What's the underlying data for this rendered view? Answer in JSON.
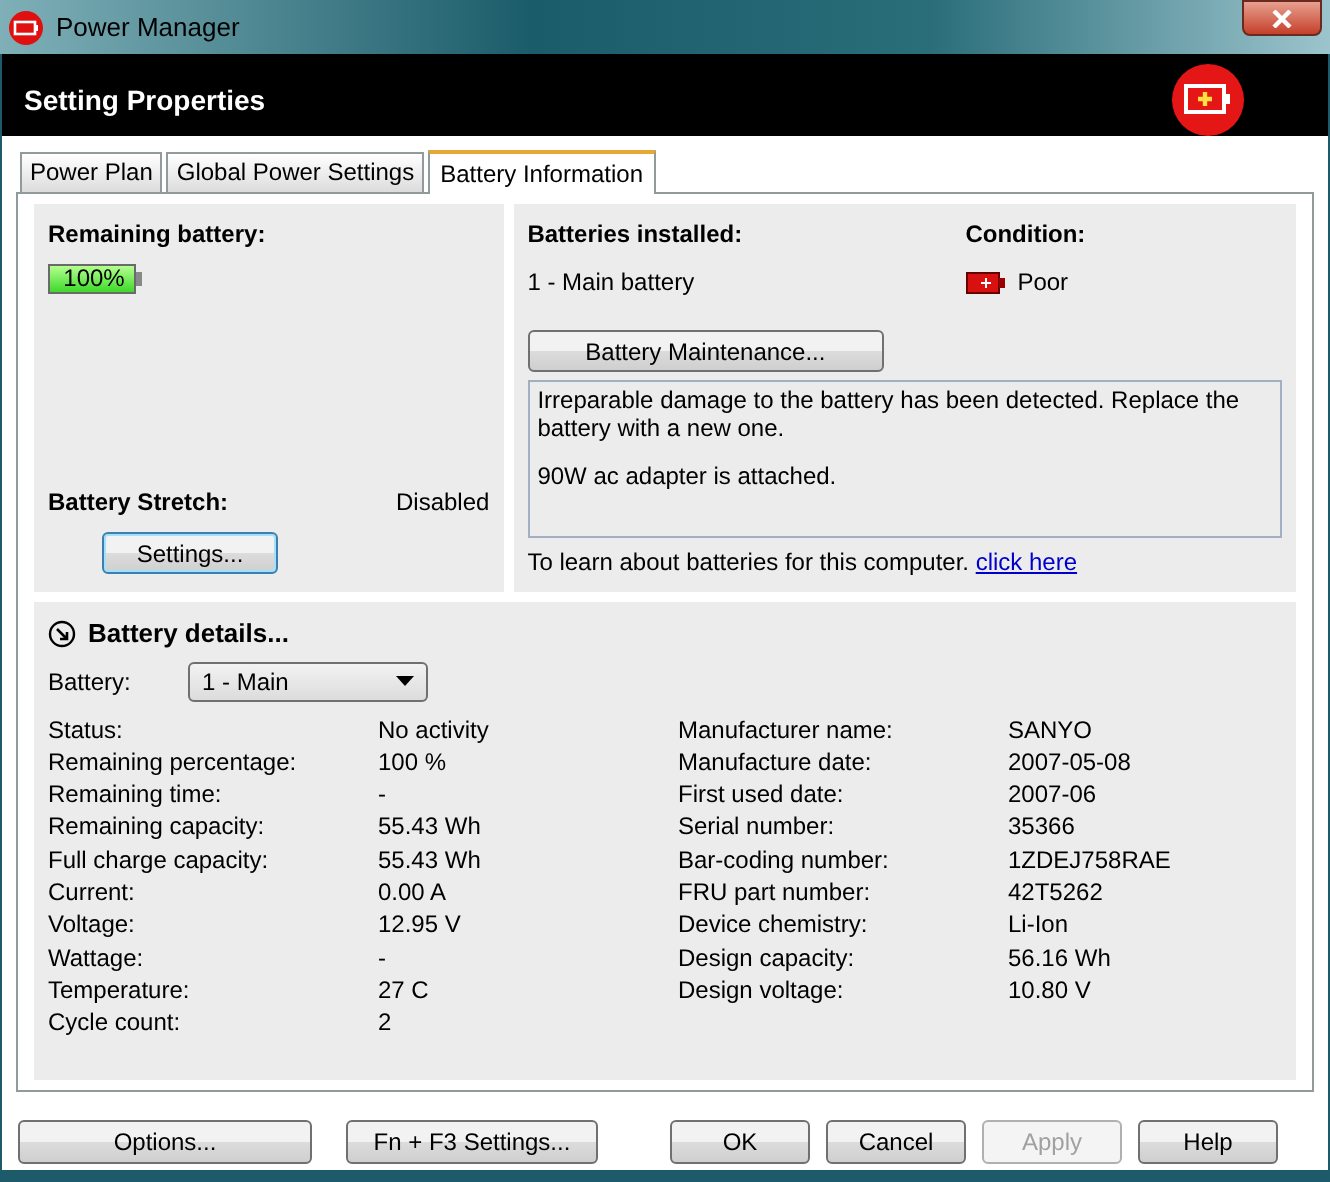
{
  "window": {
    "title": "Power Manager"
  },
  "header": {
    "title": "Setting Properties"
  },
  "tabs": [
    {
      "label": "Power Plan",
      "selected": false
    },
    {
      "label": "Global Power Settings",
      "selected": false
    },
    {
      "label": "Battery Information",
      "selected": true
    }
  ],
  "remaining": {
    "label": "Remaining battery:",
    "reading": "100%",
    "level": 1.0
  },
  "stretch": {
    "label": "Battery Stretch:",
    "value": "Disabled",
    "button": "Settings..."
  },
  "installed": {
    "label": "Batteries installed:",
    "value": "1 - Main battery"
  },
  "condition": {
    "label": "Condition:",
    "value": "Poor"
  },
  "maintenance_button": "Battery Maintenance...",
  "messages": [
    "Irreparable damage to the battery has been detected. Replace the battery with a new one.",
    "90W ac adapter is attached."
  ],
  "learn": {
    "text": "To learn about batteries for this computer.",
    "link": "click here"
  },
  "details": {
    "title": "Battery details...",
    "expanded": true,
    "battery_label": "Battery:",
    "battery_value": "1 - Main",
    "left": [
      {
        "label": "Status:",
        "value": "No activity"
      },
      {
        "label": "Remaining percentage:",
        "value": "100 %"
      },
      {
        "label": "Remaining time:",
        "value": "-"
      },
      {
        "label": "Remaining capacity:",
        "value": "55.43 Wh"
      },
      {
        "label": "Full charge capacity:",
        "value": "55.43 Wh"
      },
      {
        "label": "Current:",
        "value": "0.00 A"
      },
      {
        "label": "Voltage:",
        "value": "12.95 V"
      },
      {
        "label": "Wattage:",
        "value": "-"
      },
      {
        "label": "Temperature:",
        "value": "27 C"
      },
      {
        "label": "Cycle count:",
        "value": "2"
      }
    ],
    "right": [
      {
        "label": "Manufacturer name:",
        "value": "SANYO"
      },
      {
        "label": "Manufacture date:",
        "value": "2007-05-08"
      },
      {
        "label": "First used date:",
        "value": "2007-06"
      },
      {
        "label": "Serial number:",
        "value": "35366"
      },
      {
        "label": "Bar-coding number:",
        "value": "1ZDEJ758RAE"
      },
      {
        "label": "FRU part number:",
        "value": "42T5262"
      },
      {
        "label": "Device chemistry:",
        "value": "Li-Ion"
      },
      {
        "label": "Design capacity:",
        "value": "56.16 Wh"
      },
      {
        "label": "Design voltage:",
        "value": "10.80 V"
      }
    ]
  },
  "buttons": [
    {
      "label": "Options...",
      "disabled": false
    },
    {
      "label": "Fn + F3 Settings...",
      "disabled": false
    },
    {
      "label": "OK",
      "disabled": false
    },
    {
      "label": "Cancel",
      "disabled": false
    },
    {
      "label": "Apply",
      "disabled": true
    },
    {
      "label": "Help",
      "disabled": false
    }
  ]
}
